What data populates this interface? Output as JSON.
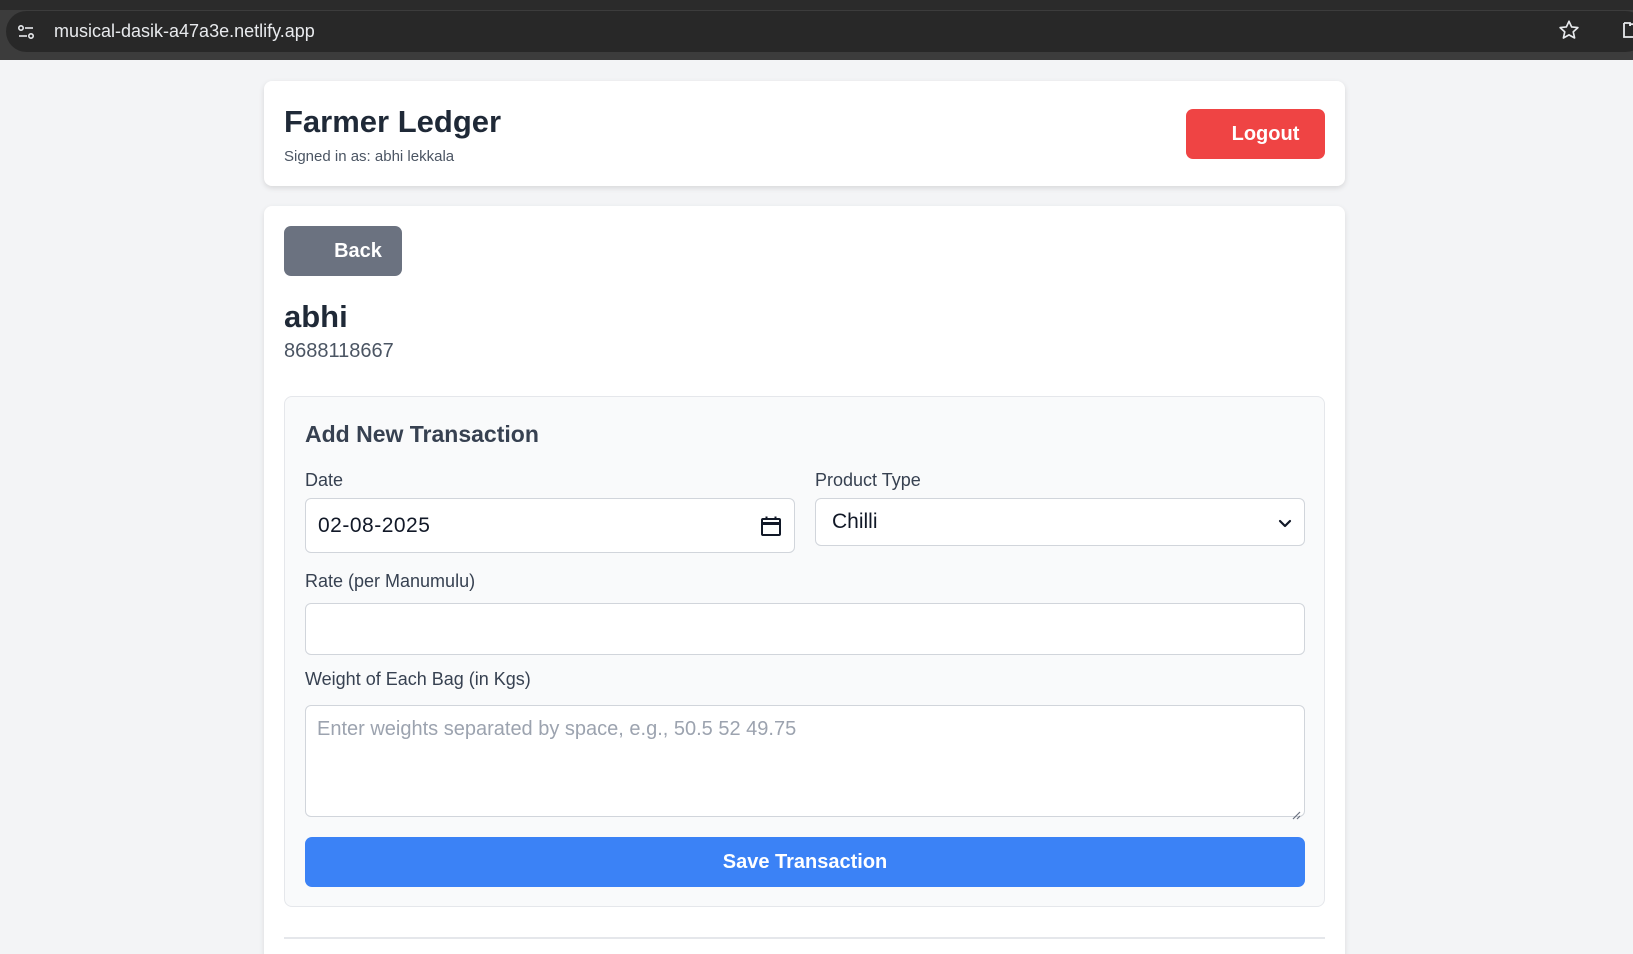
{
  "browser": {
    "url": "musical-dasik-a47a3e.netlify.app"
  },
  "header": {
    "title": "Farmer Ledger",
    "signed_in": "Signed in as: abhi lekkala",
    "logout_label": "Logout"
  },
  "main": {
    "back_label": "Back",
    "farmer_name": "abhi",
    "farmer_phone": "8688118667"
  },
  "transaction_form": {
    "title": "Add New Transaction",
    "date_label": "Date",
    "date_value": "02-08-2025",
    "product_label": "Product Type",
    "product_value": "Chilli",
    "rate_label": "Rate (per Manumulu)",
    "rate_value": "",
    "weights_label": "Weight of Each Bag (in Kgs)",
    "weights_placeholder": "Enter weights separated by space, e.g., 50.5 52 49.75",
    "save_label": "Save Transaction"
  },
  "colors": {
    "logout": "#ef4444",
    "back": "#6b7280",
    "save": "#3b82f6"
  }
}
